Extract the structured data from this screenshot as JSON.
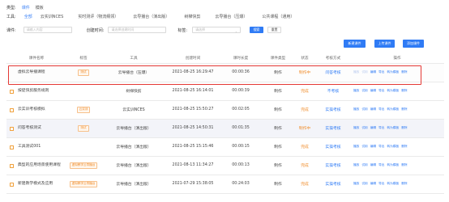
{
  "filters": {
    "type_label": "类型:",
    "type_tabs": [
      {
        "label": "课件",
        "active": true
      },
      {
        "label": "模板",
        "active": false
      }
    ],
    "tool_label": "工具:",
    "tool_tabs": [
      {
        "label": "全部",
        "active": true
      },
      {
        "label": "云实训NCES",
        "active": false
      },
      {
        "label": "实时测评（物流纲领）",
        "active": false
      },
      {
        "label": "云导播台（演出版）",
        "active": false
      },
      {
        "label": "树梯快剪",
        "active": false
      },
      {
        "label": "云导播台（压爆）",
        "active": false
      },
      {
        "label": "公共课程（通用）",
        "active": false
      }
    ],
    "course_label": "课件:",
    "course_placeholder": "请输入内容",
    "created_label": "创建时间:",
    "created_placeholder": "请选择创建时间",
    "tag_label": "标签:",
    "tag_placeholder": "请选择",
    "search_btn": "搜索",
    "reset_btn": "重置"
  },
  "toolbar": {
    "create_btn": "新建课件",
    "upload_btn": "上传课件",
    "add_btn": "添加课件"
  },
  "table": {
    "headers": [
      "课件名称",
      "标签",
      "工具",
      "创建时间",
      "课时长度",
      "课件类型",
      "状态",
      "考核方式",
      "操作"
    ],
    "rows": [
      {
        "checkbox": false,
        "name": "虚拟云导播课程",
        "tag": "测试",
        "tool": "云导播台（压爆）",
        "created": "2021-08-25 16:29:47",
        "duration": "00:00:36",
        "type": "制作",
        "status": "制作中",
        "status_color": "orange",
        "exam": "问答考核",
        "ops": [
          "播放",
          "试用",
          "编辑",
          "导出",
          "转为模板",
          "删除"
        ],
        "dim_ops": 2
      },
      {
        "checkbox": true,
        "name": "按促快剪服务规则",
        "tag": "",
        "tool": "树梯快剪",
        "created": "2021-08-25 16:14:01",
        "duration": "00:00:39",
        "type": "制作",
        "status": "完成",
        "status_color": "orange",
        "exam": "不考核",
        "ops": [
          "播放",
          "试用",
          "编辑",
          "导出",
          "转为模板",
          "删除"
        ],
        "dim_ops": 0
      },
      {
        "checkbox": true,
        "name": "云实训考核模拟",
        "tag": "云实训",
        "tool": "云实训NCES",
        "created": "2021-08-25 15:50:27",
        "duration": "00:02:05",
        "type": "制作",
        "status": "完成",
        "status_color": "orange",
        "exam": "实操考核",
        "ops": [
          "播放",
          "试用",
          "编辑",
          "导出",
          "转为模板",
          "删除"
        ],
        "dim_ops": 0
      },
      {
        "checkbox": true,
        "name": "问答考核测试",
        "tag": "测试",
        "tool": "云导播台（演出版）",
        "created": "2021-08-25 14:50:31",
        "duration": "00:01:35",
        "type": "制作",
        "status": "制作中",
        "status_color": "orange",
        "exam": "实操考核",
        "ops": [
          "播放",
          "试用",
          "编辑",
          "导出",
          "转为模板",
          "删除"
        ],
        "dim_ops": 0
      },
      {
        "checkbox": true,
        "name": "工具测试001",
        "tag": "",
        "tool": "云导播台（演出版）",
        "created": "2021-08-25 15:15:46",
        "duration": "00:00:15",
        "type": "制作",
        "status": "完成",
        "status_color": "orange",
        "exam": "实操考核",
        "ops": [
          "播放",
          "试用",
          "编辑",
          "导出",
          "转为模板",
          "删除"
        ],
        "dim_ops": 0
      },
      {
        "checkbox": true,
        "name": "典型的应用场景使用课程",
        "tag": "虚拟教学云导播台",
        "tool": "云导播台（演出版）",
        "created": "2021-08-13 11:34:27",
        "duration": "00:00:13",
        "type": "制作",
        "status": "完成",
        "status_color": "orange",
        "exam": "实操考核",
        "ops": [
          "播放",
          "试用",
          "编辑",
          "导出",
          "转为模板",
          "删除"
        ],
        "dim_ops": 0
      },
      {
        "checkbox": true,
        "name": "新建教学模式及应用",
        "tag": "虚拟教学云导播台",
        "tool": "云导播台（演出版）",
        "created": "2021-07-29 15:38:05",
        "duration": "00:24:03",
        "type": "制作",
        "status": "完成",
        "status_color": "orange",
        "exam": "实操考核",
        "ops": [
          "播放",
          "试用",
          "编辑",
          "导出",
          "转为模板",
          "删除"
        ],
        "dim_ops": 0
      }
    ]
  }
}
